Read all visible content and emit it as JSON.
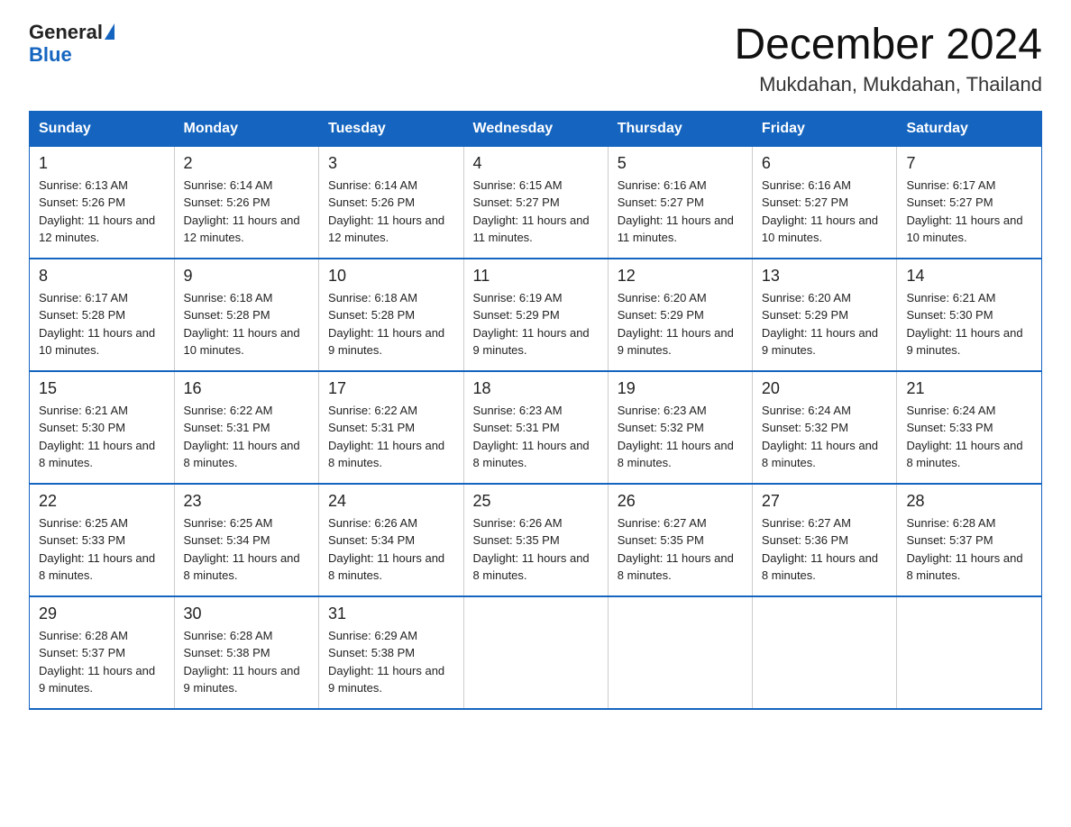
{
  "logo": {
    "general": "General",
    "blue": "Blue"
  },
  "title": "December 2024",
  "subtitle": "Mukdahan, Mukdahan, Thailand",
  "days_of_week": [
    "Sunday",
    "Monday",
    "Tuesday",
    "Wednesday",
    "Thursday",
    "Friday",
    "Saturday"
  ],
  "weeks": [
    [
      {
        "day": "1",
        "sunrise": "6:13 AM",
        "sunset": "5:26 PM",
        "daylight": "11 hours and 12 minutes."
      },
      {
        "day": "2",
        "sunrise": "6:14 AM",
        "sunset": "5:26 PM",
        "daylight": "11 hours and 12 minutes."
      },
      {
        "day": "3",
        "sunrise": "6:14 AM",
        "sunset": "5:26 PM",
        "daylight": "11 hours and 12 minutes."
      },
      {
        "day": "4",
        "sunrise": "6:15 AM",
        "sunset": "5:27 PM",
        "daylight": "11 hours and 11 minutes."
      },
      {
        "day": "5",
        "sunrise": "6:16 AM",
        "sunset": "5:27 PM",
        "daylight": "11 hours and 11 minutes."
      },
      {
        "day": "6",
        "sunrise": "6:16 AM",
        "sunset": "5:27 PM",
        "daylight": "11 hours and 10 minutes."
      },
      {
        "day": "7",
        "sunrise": "6:17 AM",
        "sunset": "5:27 PM",
        "daylight": "11 hours and 10 minutes."
      }
    ],
    [
      {
        "day": "8",
        "sunrise": "6:17 AM",
        "sunset": "5:28 PM",
        "daylight": "11 hours and 10 minutes."
      },
      {
        "day": "9",
        "sunrise": "6:18 AM",
        "sunset": "5:28 PM",
        "daylight": "11 hours and 10 minutes."
      },
      {
        "day": "10",
        "sunrise": "6:18 AM",
        "sunset": "5:28 PM",
        "daylight": "11 hours and 9 minutes."
      },
      {
        "day": "11",
        "sunrise": "6:19 AM",
        "sunset": "5:29 PM",
        "daylight": "11 hours and 9 minutes."
      },
      {
        "day": "12",
        "sunrise": "6:20 AM",
        "sunset": "5:29 PM",
        "daylight": "11 hours and 9 minutes."
      },
      {
        "day": "13",
        "sunrise": "6:20 AM",
        "sunset": "5:29 PM",
        "daylight": "11 hours and 9 minutes."
      },
      {
        "day": "14",
        "sunrise": "6:21 AM",
        "sunset": "5:30 PM",
        "daylight": "11 hours and 9 minutes."
      }
    ],
    [
      {
        "day": "15",
        "sunrise": "6:21 AM",
        "sunset": "5:30 PM",
        "daylight": "11 hours and 8 minutes."
      },
      {
        "day": "16",
        "sunrise": "6:22 AM",
        "sunset": "5:31 PM",
        "daylight": "11 hours and 8 minutes."
      },
      {
        "day": "17",
        "sunrise": "6:22 AM",
        "sunset": "5:31 PM",
        "daylight": "11 hours and 8 minutes."
      },
      {
        "day": "18",
        "sunrise": "6:23 AM",
        "sunset": "5:31 PM",
        "daylight": "11 hours and 8 minutes."
      },
      {
        "day": "19",
        "sunrise": "6:23 AM",
        "sunset": "5:32 PM",
        "daylight": "11 hours and 8 minutes."
      },
      {
        "day": "20",
        "sunrise": "6:24 AM",
        "sunset": "5:32 PM",
        "daylight": "11 hours and 8 minutes."
      },
      {
        "day": "21",
        "sunrise": "6:24 AM",
        "sunset": "5:33 PM",
        "daylight": "11 hours and 8 minutes."
      }
    ],
    [
      {
        "day": "22",
        "sunrise": "6:25 AM",
        "sunset": "5:33 PM",
        "daylight": "11 hours and 8 minutes."
      },
      {
        "day": "23",
        "sunrise": "6:25 AM",
        "sunset": "5:34 PM",
        "daylight": "11 hours and 8 minutes."
      },
      {
        "day": "24",
        "sunrise": "6:26 AM",
        "sunset": "5:34 PM",
        "daylight": "11 hours and 8 minutes."
      },
      {
        "day": "25",
        "sunrise": "6:26 AM",
        "sunset": "5:35 PM",
        "daylight": "11 hours and 8 minutes."
      },
      {
        "day": "26",
        "sunrise": "6:27 AM",
        "sunset": "5:35 PM",
        "daylight": "11 hours and 8 minutes."
      },
      {
        "day": "27",
        "sunrise": "6:27 AM",
        "sunset": "5:36 PM",
        "daylight": "11 hours and 8 minutes."
      },
      {
        "day": "28",
        "sunrise": "6:28 AM",
        "sunset": "5:37 PM",
        "daylight": "11 hours and 8 minutes."
      }
    ],
    [
      {
        "day": "29",
        "sunrise": "6:28 AM",
        "sunset": "5:37 PM",
        "daylight": "11 hours and 9 minutes."
      },
      {
        "day": "30",
        "sunrise": "6:28 AM",
        "sunset": "5:38 PM",
        "daylight": "11 hours and 9 minutes."
      },
      {
        "day": "31",
        "sunrise": "6:29 AM",
        "sunset": "5:38 PM",
        "daylight": "11 hours and 9 minutes."
      },
      null,
      null,
      null,
      null
    ]
  ]
}
